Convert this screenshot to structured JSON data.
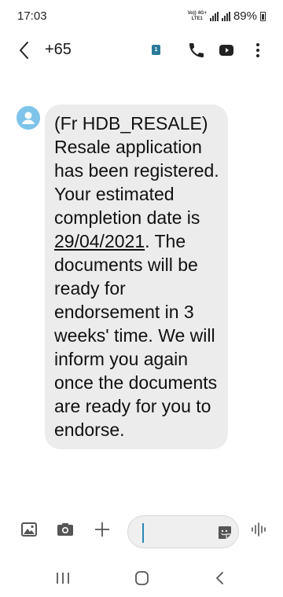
{
  "status_bar": {
    "time": "17:03",
    "net_top": "Vo)) 4G+",
    "net_bottom": "LTE1",
    "battery": "89%"
  },
  "header": {
    "contact": "+65",
    "sim_number": "1",
    "icons": [
      "back-icon",
      "phone-icon",
      "video-call-icon",
      "more-options-icon"
    ]
  },
  "message": {
    "part1": "(Fr HDB_RESALE) Resale application has been registered. Your estimated completion date is ",
    "date": "29/04/2021",
    "part2": ". The documents will be ready for endorsement in 3 weeks' time. We will inform you again once the documents are ready for you to endorse."
  },
  "compose": {
    "placeholder": "",
    "icons": [
      "gallery-icon",
      "camera-icon",
      "plus-icon",
      "sticker-icon",
      "voice-icon"
    ]
  },
  "nav_bar": {
    "icons": [
      "recents-icon",
      "home-icon",
      "back-nav-icon"
    ]
  },
  "colors": {
    "bubble": "#ececec",
    "avatar": "#7ec3ea",
    "accent": "#2a87b8"
  }
}
